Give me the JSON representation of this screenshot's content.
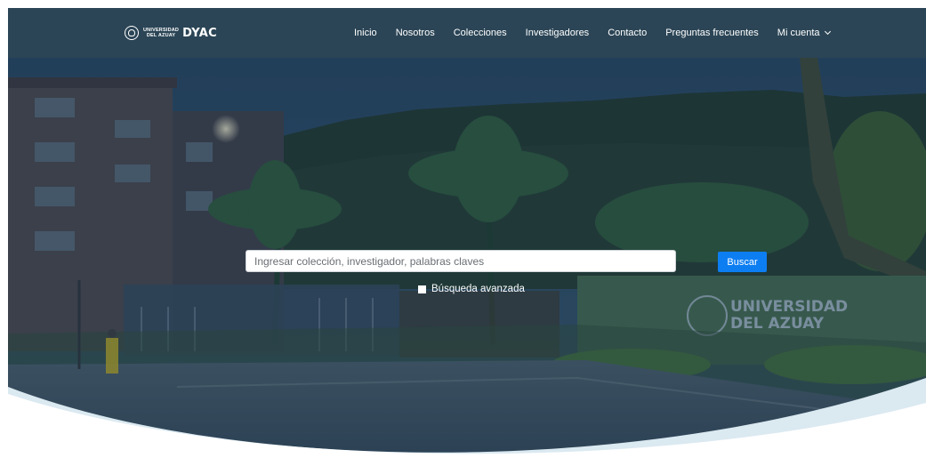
{
  "brand": {
    "line1": "UNIVERSIDAD",
    "line2": "DEL AZUAY",
    "name": "DYAC"
  },
  "nav": {
    "items": [
      "Inicio",
      "Nosotros",
      "Colecciones",
      "Investigadores",
      "Contacto",
      "Preguntas frecuentes"
    ],
    "account": "Mi cuenta"
  },
  "search": {
    "placeholder": "Ingresar colección, investigador, palabras claves",
    "value": "",
    "button": "Buscar",
    "advanced": "Búsqueda avanzada"
  },
  "sign": {
    "line1": "UNIVERSIDAD",
    "line2": "DEL AZUAY"
  },
  "colors": {
    "navbar": "#2b4556",
    "accent": "#0d7ef2",
    "overlay": "#1f3a52"
  }
}
